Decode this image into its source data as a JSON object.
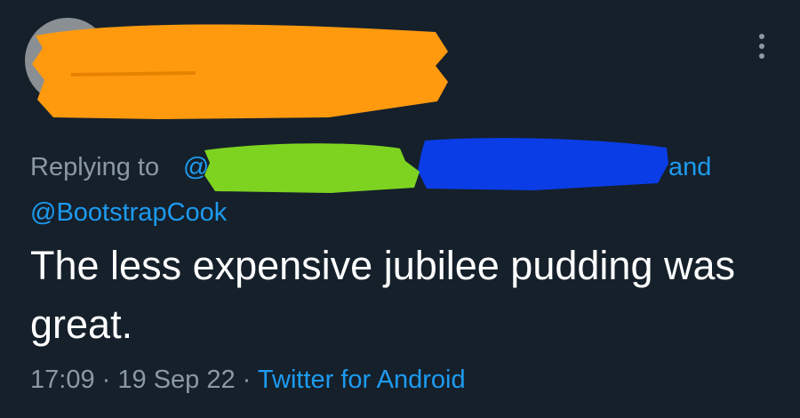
{
  "header": {
    "more_icon": "more-vertical-icon"
  },
  "reply": {
    "prefix": "Replying to",
    "first_mention_visible": "@",
    "conjunction": "and",
    "second_mention": "@BootstrapCook"
  },
  "tweet": {
    "text": "The less expensive jubilee pudding was great.",
    "time": "17:09",
    "separator": "·",
    "date": "19 Sep 22",
    "source": "Twitter for Android"
  },
  "colors": {
    "background": "#15202b",
    "text": "#ffffff",
    "muted": "#8b98a5",
    "link": "#1d9bf0",
    "redaction_orange": "#ff9a0f",
    "redaction_green": "#7ed321",
    "redaction_blue": "#0a3de6"
  }
}
